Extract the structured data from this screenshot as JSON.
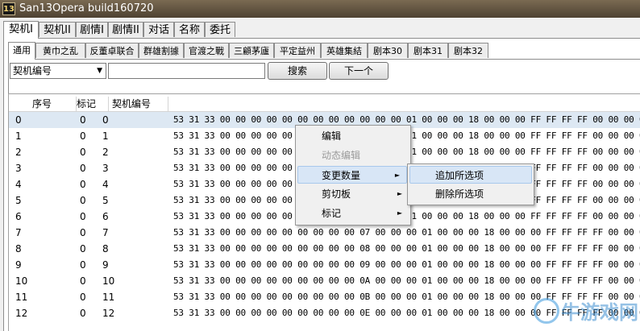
{
  "window": {
    "title": "San13Opera build160720",
    "icon_label": "13"
  },
  "main_tabs": [
    "契机I",
    "契机II",
    "剧情I",
    "剧情II",
    "对话",
    "名称",
    "委托"
  ],
  "sub_tabs": [
    "通用",
    "黄巾之乱",
    "反董卓联合",
    "群雄割據",
    "官渡之戰",
    "三顧茅廬",
    "平定益州",
    "英雄集結",
    "剧本30",
    "剧本31",
    "剧本32"
  ],
  "toolbar": {
    "field_select": "契机编号",
    "search_label": "搜索",
    "next_label": "下一个"
  },
  "grid": {
    "headers": [
      "序号",
      "标记",
      "契机编号"
    ],
    "rows": [
      {
        "idx": "0",
        "mark": "0",
        "id": "0",
        "hex": "53 31 33 00 00 00 00 00 00 00 00 00 00 00 00 01 00 00 00 18 00 00 00 FF FF FF FF 00 00 00 00 10 0"
      },
      {
        "idx": "1",
        "mark": "0",
        "id": "1",
        "hex": "53 31 33 00 00 00 00 00 00 00 00 00 00 00 00 01 00 00 00 18 00 00 00 FF FF FF FF 00 00 00 00 00 0"
      },
      {
        "idx": "2",
        "mark": "0",
        "id": "2",
        "hex": "53 31 33 00 00 00 00 00 00 00 00 00 00 00 00 01 00 00 00 18 00 00 00 FF FF FF FF 00 00 00 00 00 0"
      },
      {
        "idx": "3",
        "mark": "0",
        "id": "3",
        "hex": "53 31 33 00 00 00 00 00 00 00 00 00 00 00 00 01 00 00 00 18 00 00 00 FF FF FF FF 00 00 00 00 00 0"
      },
      {
        "idx": "4",
        "mark": "0",
        "id": "4",
        "hex": "53 31 33 00 00 00 00 00 00 00 00 00 00 00 00 01 00 00 00 18 00 00 00 FF FF FF FF 00 00 00 00 00 0"
      },
      {
        "idx": "5",
        "mark": "0",
        "id": "5",
        "hex": "53 31 33 00 00 00 00 00 00 00 00 00 00 00 00 01 00 00 00 18 00 00 00 FF FF FF FF 00 00 00 00 00 0"
      },
      {
        "idx": "6",
        "mark": "0",
        "id": "6",
        "hex": "53 31 33 00 00 00 00 00 00 00 00 00 00 00 00 01 00 00 00 18 00 00 00 FF FF FF FF 00 00 00 00 00 0"
      },
      {
        "idx": "7",
        "mark": "0",
        "id": "7",
        "hex": "53 31 33 00 00 00 00 00 00 00 00 00 07 00 00 00 01 00 00 00 18 00 00 00 FF FF FF FF 00 00 00 00 0"
      },
      {
        "idx": "8",
        "mark": "0",
        "id": "8",
        "hex": "53 31 33 00 00 00 00 00 00 00 00 00 08 00 00 00 01 00 00 00 18 00 00 00 FF FF FF FF 00 00 00 00 0"
      },
      {
        "idx": "9",
        "mark": "0",
        "id": "9",
        "hex": "53 31 33 00 00 00 00 00 00 00 00 00 09 00 00 00 01 00 00 00 18 00 00 00 FF FF FF FF 00 00 00 00 0"
      },
      {
        "idx": "10",
        "mark": "0",
        "id": "10",
        "hex": "53 31 33 00 00 00 00 00 00 00 00 00 0A 00 00 00 01 00 00 00 18 00 00 00 FF FF FF FF 00 00 00 00 0"
      },
      {
        "idx": "11",
        "mark": "0",
        "id": "11",
        "hex": "53 31 33 00 00 00 00 00 00 00 00 00 0B 00 00 00 01 00 00 00 18 00 00 00 FF FF FF FF 00 00 00 00 0"
      },
      {
        "idx": "12",
        "mark": "0",
        "id": "12",
        "hex": "53 31 33 00 00 00 00 00 00 00 00 00 0E 00 00 00 01 00 00 00 18 00 00 00 FF FF FF FF 00 00 00 00 0"
      }
    ]
  },
  "context_menu": {
    "items": [
      {
        "label": "编辑",
        "disabled": false,
        "submenu": false
      },
      {
        "label": "动态编辑",
        "disabled": true,
        "submenu": false
      },
      {
        "label": "变更数量",
        "disabled": false,
        "submenu": true,
        "highlighted": true
      },
      {
        "label": "剪切板",
        "disabled": false,
        "submenu": true
      },
      {
        "label": "标记",
        "disabled": false,
        "submenu": true
      }
    ],
    "submenu": [
      "追加所选项",
      "删除所选项"
    ]
  },
  "watermark": {
    "text": "牛游戏网"
  }
}
